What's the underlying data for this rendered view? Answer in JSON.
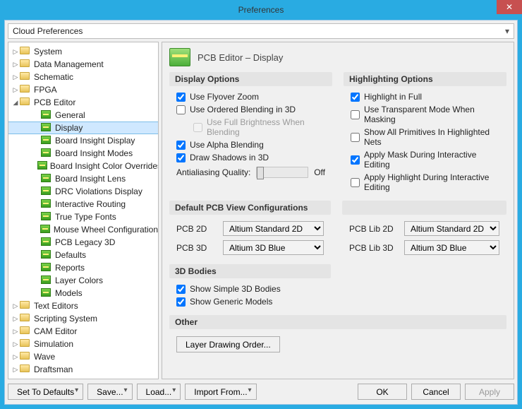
{
  "window": {
    "title": "Preferences"
  },
  "topbar": {
    "selected": "Cloud Preferences"
  },
  "tree": {
    "items": [
      {
        "label": "System",
        "icon": "folder",
        "depth": 0,
        "expand": "closed"
      },
      {
        "label": "Data Management",
        "icon": "folder",
        "depth": 0,
        "expand": "closed"
      },
      {
        "label": "Schematic",
        "icon": "folder",
        "depth": 0,
        "expand": "closed"
      },
      {
        "label": "FPGA",
        "icon": "folder",
        "depth": 0,
        "expand": "closed"
      },
      {
        "label": "PCB Editor",
        "icon": "folder",
        "depth": 0,
        "expand": "open"
      },
      {
        "label": "General",
        "icon": "pcb",
        "depth": 1,
        "expand": "leaf"
      },
      {
        "label": "Display",
        "icon": "pcb",
        "depth": 1,
        "expand": "leaf",
        "selected": true
      },
      {
        "label": "Board Insight Display",
        "icon": "pcb",
        "depth": 1,
        "expand": "leaf"
      },
      {
        "label": "Board Insight Modes",
        "icon": "pcb",
        "depth": 1,
        "expand": "leaf"
      },
      {
        "label": "Board Insight Color Overrides",
        "icon": "pcb",
        "depth": 1,
        "expand": "leaf"
      },
      {
        "label": "Board Insight Lens",
        "icon": "pcb",
        "depth": 1,
        "expand": "leaf"
      },
      {
        "label": "DRC Violations Display",
        "icon": "pcb",
        "depth": 1,
        "expand": "leaf"
      },
      {
        "label": "Interactive Routing",
        "icon": "pcb",
        "depth": 1,
        "expand": "leaf"
      },
      {
        "label": "True Type Fonts",
        "icon": "pcb",
        "depth": 1,
        "expand": "leaf"
      },
      {
        "label": "Mouse Wheel Configuration",
        "icon": "pcb",
        "depth": 1,
        "expand": "leaf"
      },
      {
        "label": "PCB Legacy 3D",
        "icon": "pcb",
        "depth": 1,
        "expand": "leaf"
      },
      {
        "label": "Defaults",
        "icon": "pcb",
        "depth": 1,
        "expand": "leaf"
      },
      {
        "label": "Reports",
        "icon": "pcb",
        "depth": 1,
        "expand": "leaf"
      },
      {
        "label": "Layer Colors",
        "icon": "pcb",
        "depth": 1,
        "expand": "leaf"
      },
      {
        "label": "Models",
        "icon": "pcb",
        "depth": 1,
        "expand": "leaf"
      },
      {
        "label": "Text Editors",
        "icon": "folder",
        "depth": 0,
        "expand": "closed"
      },
      {
        "label": "Scripting System",
        "icon": "folder",
        "depth": 0,
        "expand": "closed"
      },
      {
        "label": "CAM Editor",
        "icon": "folder",
        "depth": 0,
        "expand": "closed"
      },
      {
        "label": "Simulation",
        "icon": "folder",
        "depth": 0,
        "expand": "closed"
      },
      {
        "label": "Wave",
        "icon": "folder",
        "depth": 0,
        "expand": "closed"
      },
      {
        "label": "Draftsman",
        "icon": "folder",
        "depth": 0,
        "expand": "closed"
      }
    ]
  },
  "page": {
    "title": "PCB Editor – Display",
    "groups": {
      "display_options": {
        "title": "Display Options",
        "items": {
          "flyover": {
            "label": "Use Flyover Zoom",
            "checked": true
          },
          "ordered": {
            "label": "Use Ordered Blending in 3D",
            "checked": false
          },
          "fullbright": {
            "label": "Use Full Brightness When Blending",
            "checked": false,
            "disabled": true
          },
          "alpha": {
            "label": "Use Alpha Blending",
            "checked": true
          },
          "shadows": {
            "label": "Draw Shadows in 3D",
            "checked": true
          }
        },
        "slider": {
          "label": "Antialiasing Quality:",
          "right": "Off"
        }
      },
      "highlight": {
        "title": "Highlighting Options",
        "items": {
          "full": {
            "label": "Highlight in Full",
            "checked": true
          },
          "transparent": {
            "label": "Use Transparent Mode When Masking",
            "checked": false
          },
          "primitives": {
            "label": "Show All Primitives In Highlighted Nets",
            "checked": false
          },
          "mask_edit": {
            "label": "Apply Mask During Interactive Editing",
            "checked": true
          },
          "hl_edit": {
            "label": "Apply Highlight During Interactive Editing",
            "checked": false
          }
        }
      },
      "defaultview": {
        "title": "Default PCB View Configurations",
        "pcb2d": {
          "label": "PCB 2D",
          "value": "Altium Standard 2D"
        },
        "pcb3d": {
          "label": "PCB 3D",
          "value": "Altium 3D Blue"
        },
        "lib2d": {
          "label": "PCB Lib 2D",
          "value": "Altium Standard 2D"
        },
        "lib3d": {
          "label": "PCB Lib 3D",
          "value": "Altium 3D Blue"
        }
      },
      "bodies": {
        "title": "3D Bodies",
        "simple": {
          "label": "Show Simple 3D Bodies",
          "checked": true
        },
        "generic": {
          "label": "Show Generic Models",
          "checked": true
        }
      },
      "other": {
        "title": "Other",
        "button": "Layer Drawing Order..."
      }
    }
  },
  "footer": {
    "set_defaults": "Set To Defaults",
    "save": "Save...",
    "load": "Load...",
    "import": "Import From...",
    "ok": "OK",
    "cancel": "Cancel",
    "apply": "Apply"
  }
}
